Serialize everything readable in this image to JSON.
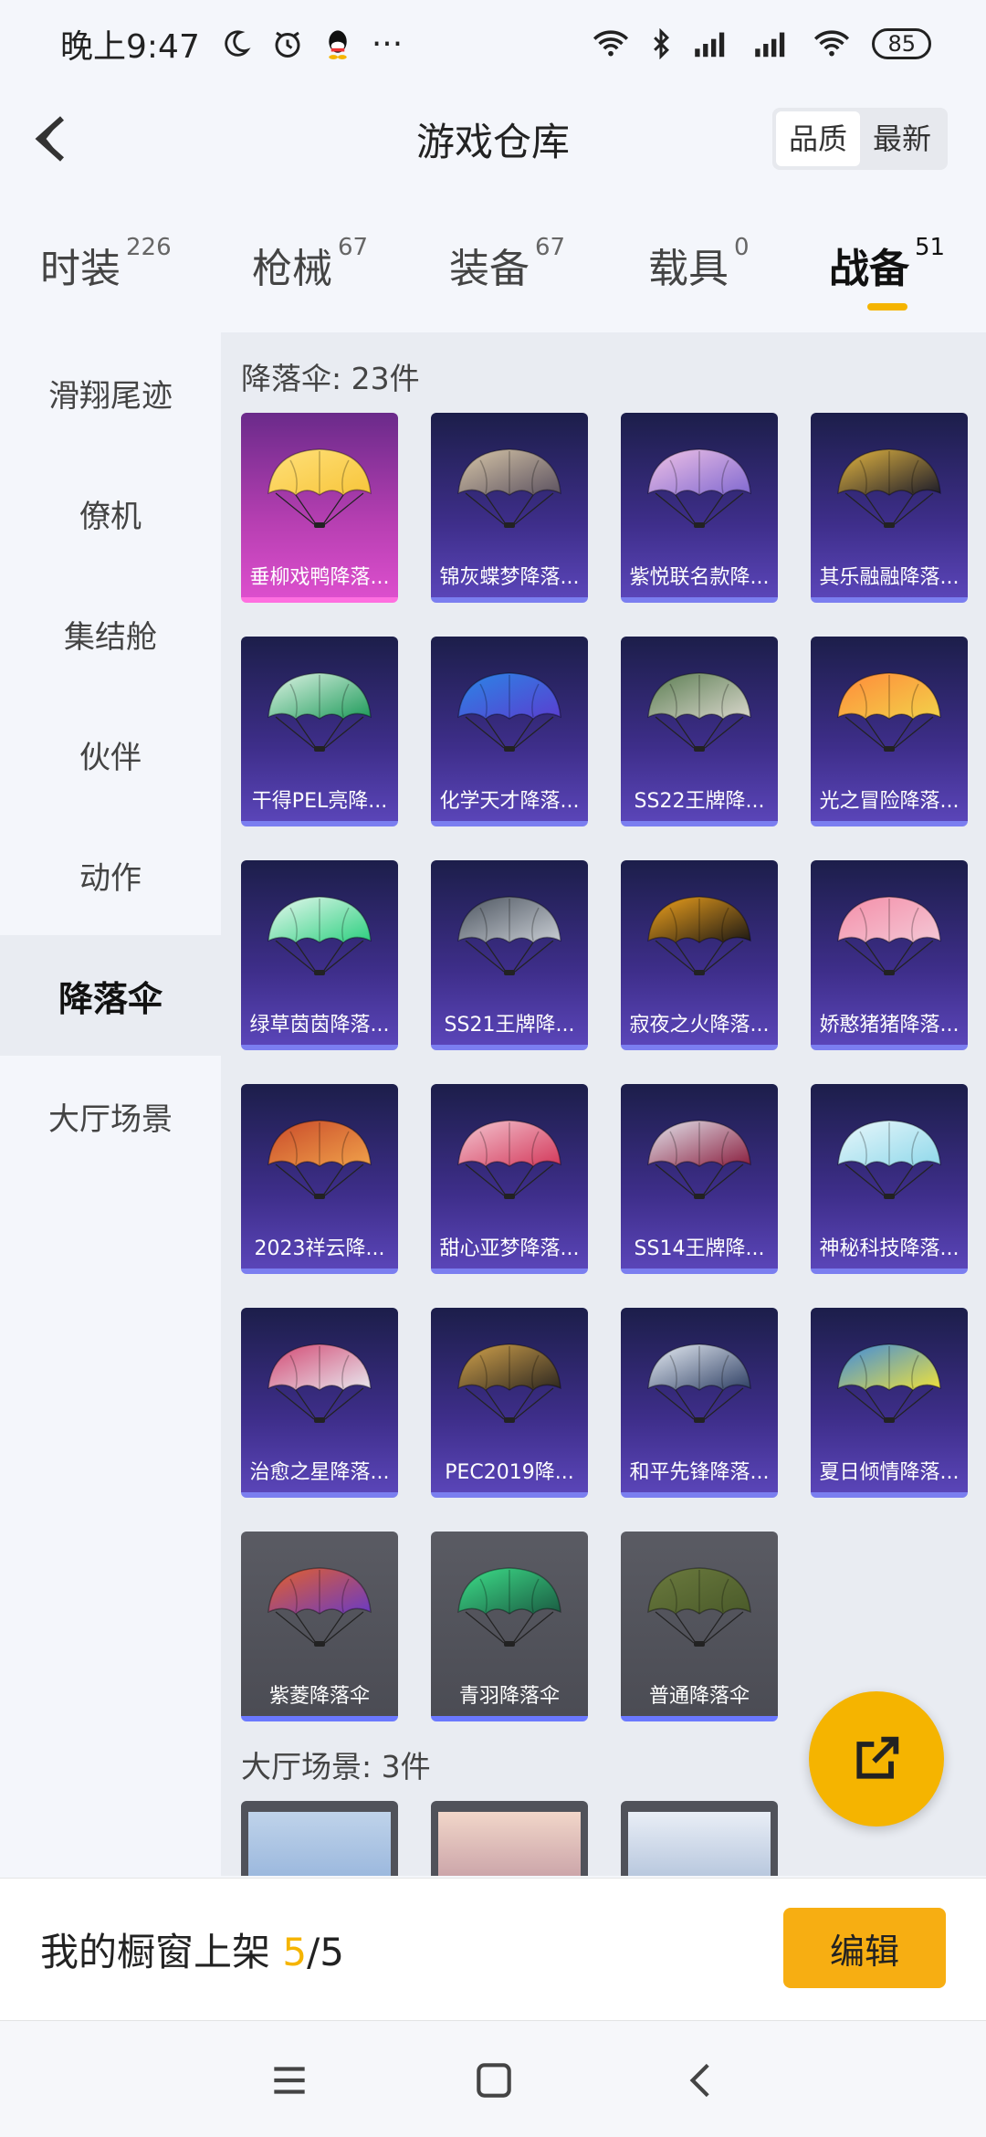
{
  "status_bar": {
    "time": "晚上9:47",
    "moon_icon": "moon-icon",
    "alarm_icon": "alarm-icon",
    "qq_icon": "qq-icon",
    "more": "···",
    "battery": "85"
  },
  "header": {
    "title": "游戏仓库",
    "sort_options": [
      "品质",
      "最新"
    ],
    "sort_active": "品质"
  },
  "tabs": [
    {
      "label": "时装",
      "count": "226"
    },
    {
      "label": "枪械",
      "count": "67"
    },
    {
      "label": "装备",
      "count": "67"
    },
    {
      "label": "载具",
      "count": "0"
    },
    {
      "label": "战备",
      "count": "51",
      "active": true
    }
  ],
  "sidebar": {
    "items": [
      "滑翔尾迹",
      "僚机",
      "集结舱",
      "伙伴",
      "动作",
      "降落伞",
      "大厅场景"
    ],
    "active": "降落伞"
  },
  "sections": {
    "parachute_title": "降落伞: 23件",
    "lobby_title": "大厅场景: 3件"
  },
  "parachutes": [
    {
      "name": "垂柳戏鸭降落...",
      "rarity": "pink",
      "colors": [
        "#f7c53a",
        "#ffe07a"
      ]
    },
    {
      "name": "锦灰蝶梦降落...",
      "rarity": "purple",
      "colors": [
        "#5b5160",
        "#d8c7a8"
      ]
    },
    {
      "name": "紫悦联名款降...",
      "rarity": "purple",
      "colors": [
        "#7f68d0",
        "#f0c2e6"
      ]
    },
    {
      "name": "其乐融融降落...",
      "rarity": "purple",
      "colors": [
        "#1a1a2a",
        "#e4b640"
      ]
    },
    {
      "name": "干得PEL亮降...",
      "rarity": "purple",
      "colors": [
        "#1e9a5a",
        "#dff5e6"
      ]
    },
    {
      "name": "化学天才降落...",
      "rarity": "purple",
      "colors": [
        "#5a3ed0",
        "#2a86e6"
      ]
    },
    {
      "name": "SS22王牌降...",
      "rarity": "purple",
      "colors": [
        "#d9d7cc",
        "#5b7d52"
      ]
    },
    {
      "name": "光之冒险降落...",
      "rarity": "purple",
      "colors": [
        "#f2d24a",
        "#ff8a3a"
      ]
    },
    {
      "name": "绿草茵茵降落...",
      "rarity": "purple",
      "colors": [
        "#2ccf7f",
        "#e8f9f0"
      ]
    },
    {
      "name": "SS21王牌降...",
      "rarity": "purple",
      "colors": [
        "#c9ced4",
        "#4d5560"
      ]
    },
    {
      "name": "寂夜之火降落...",
      "rarity": "purple",
      "colors": [
        "#1a1714",
        "#f0a21c"
      ]
    },
    {
      "name": "娇憨猪猪降落...",
      "rarity": "purple",
      "colors": [
        "#f3c8d6",
        "#f58ea8"
      ]
    },
    {
      "name": "2023祥云降...",
      "rarity": "purple",
      "colors": [
        "#f0a14a",
        "#c94a2a"
      ]
    },
    {
      "name": "甜心亚梦降落...",
      "rarity": "purple",
      "colors": [
        "#d3385a",
        "#f4c6d1"
      ]
    },
    {
      "name": "SS14王牌降...",
      "rarity": "purple",
      "colors": [
        "#8a1e3e",
        "#e3e6ee"
      ]
    },
    {
      "name": "神秘科技降落...",
      "rarity": "purple",
      "colors": [
        "#8fd8ea",
        "#e9f7fb"
      ]
    },
    {
      "name": "治愈之星降落...",
      "rarity": "purple",
      "colors": [
        "#e8e9f0",
        "#d34872"
      ]
    },
    {
      "name": "PEC2019降...",
      "rarity": "purple",
      "colors": [
        "#2b2620",
        "#d2a24b"
      ]
    },
    {
      "name": "和平先锋降落...",
      "rarity": "purple",
      "colors": [
        "#2e3f64",
        "#e8eef5"
      ]
    },
    {
      "name": "夏日倾情降落...",
      "rarity": "purple",
      "colors": [
        "#f0e23a",
        "#3c8ae0"
      ]
    },
    {
      "name": "紫菱降落伞",
      "rarity": "gray",
      "colors": [
        "#6a3bc4",
        "#e4602a"
      ]
    },
    {
      "name": "青羽降落伞",
      "rarity": "gray",
      "colors": [
        "#1b5b42",
        "#3de08a"
      ]
    },
    {
      "name": "普通降落伞",
      "rarity": "gray",
      "colors": [
        "#4a5a2a",
        "#6b7a3e"
      ]
    }
  ],
  "bottom_bar": {
    "label": "我的橱窗上架 ",
    "current": "5",
    "total": "/5",
    "edit_label": "编辑"
  }
}
